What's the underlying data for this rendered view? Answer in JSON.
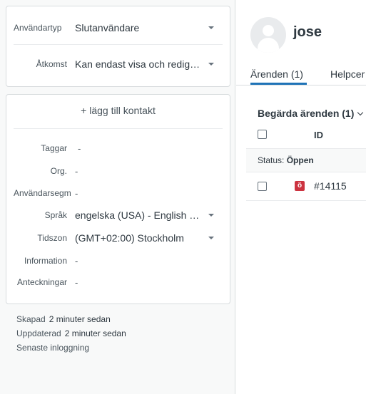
{
  "user_fields": {
    "user_type": {
      "label": "Användartyp",
      "value": "Slutanvändare"
    },
    "access": {
      "label": "Åtkomst",
      "value": "Kan endast visa och redig…"
    }
  },
  "contact": {
    "add_label": "+ lägg till kontakt",
    "tags": {
      "label": "Taggar",
      "value": "-"
    },
    "org": {
      "label": "Org.",
      "value": "-"
    },
    "segment": {
      "label": "Användarsegm",
      "value": "-"
    },
    "language": {
      "label": "Språk",
      "value": "engelska (USA) - English …"
    },
    "timezone": {
      "label": "Tidszon",
      "value": "(GMT+02:00) Stockholm"
    },
    "information": {
      "label": "Information",
      "value": "-"
    },
    "notes": {
      "label": "Anteckningar",
      "value": "-"
    }
  },
  "meta": {
    "created_label": "Skapad",
    "created_value": "2 minuter sedan",
    "updated_label": "Uppdaterad",
    "updated_value": "2 minuter sedan",
    "last_login_label": "Senaste inloggning"
  },
  "profile": {
    "name": "jose"
  },
  "tabs": [
    {
      "label": "Ärenden (1)",
      "active": true
    },
    {
      "label": "Helpcer"
    }
  ],
  "tickets": {
    "section_title": "Begärda ärenden (1)",
    "column_id": "ID",
    "status_label": "Status:",
    "status_value": "Öppen",
    "rows": [
      {
        "badge": "ö",
        "id": "#14115",
        "badge_color": "#cc3340"
      }
    ]
  },
  "colors": {
    "accent": "#1f73b7",
    "open_status": "#cc3340"
  }
}
